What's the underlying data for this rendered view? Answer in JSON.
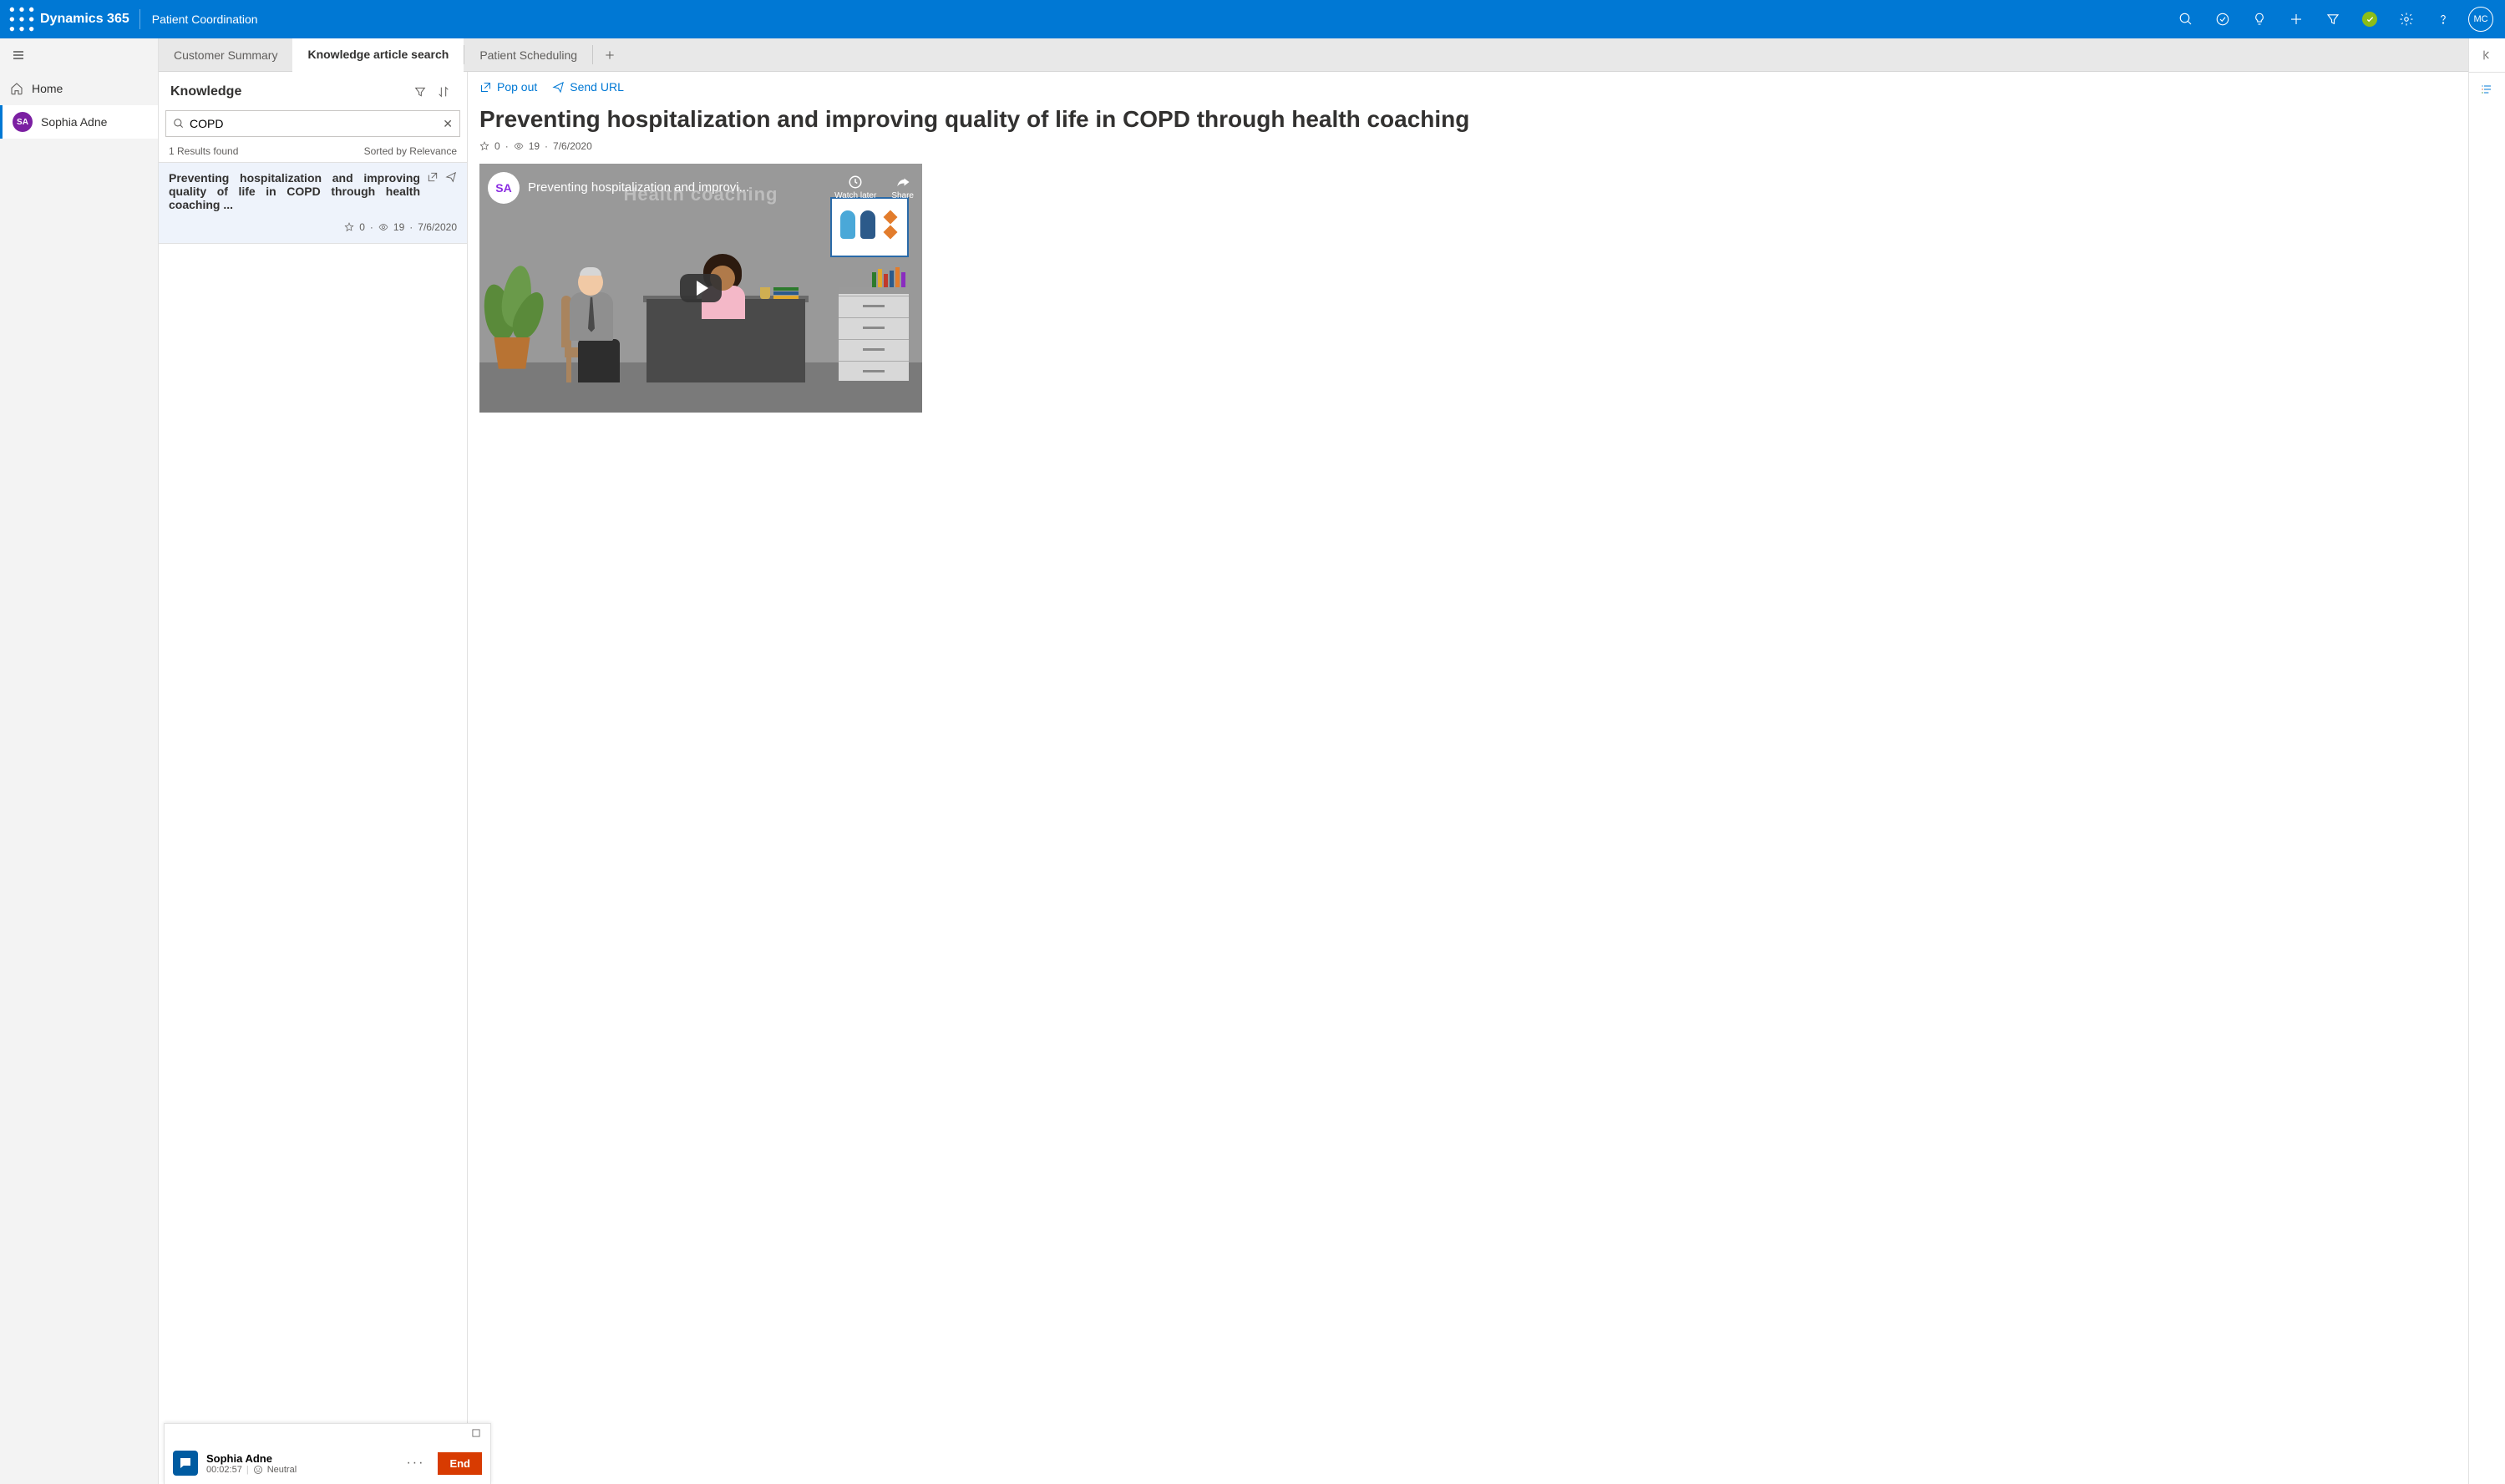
{
  "nav": {
    "brand": "Dynamics 365",
    "app": "Patient Coordination",
    "user_initials": "MC"
  },
  "sidebar": {
    "home": "Home",
    "session": {
      "avatar": "SA",
      "name": "Sophia Adne"
    }
  },
  "tabs": {
    "summary": "Customer Summary",
    "knowledge": "Knowledge article search",
    "scheduling": "Patient Scheduling"
  },
  "knowledge": {
    "title": "Knowledge",
    "search_value": "COPD",
    "results_found": "1 Results found",
    "sorted_by": "Sorted by Relevance",
    "result": {
      "title": "Preventing hospitalization and improving quality of life in COPD through health coaching  ...",
      "rating": "0",
      "views": "19",
      "date": "7/6/2020"
    }
  },
  "article": {
    "popout": "Pop out",
    "sendurl": "Send URL",
    "title": "Preventing hospitalization and improving quality of life in COPD through health coaching",
    "rating": "0",
    "views": "19",
    "date": "7/6/2020",
    "video": {
      "channel_avatar": "SA",
      "title": "Preventing hospitalization and improvi...",
      "wall_text": "Health coaching",
      "watch_later": "Watch later",
      "share": "Share"
    }
  },
  "chat": {
    "name": "Sophia Adne",
    "duration": "00:02:57",
    "sentiment": "Neutral",
    "end": "End"
  }
}
